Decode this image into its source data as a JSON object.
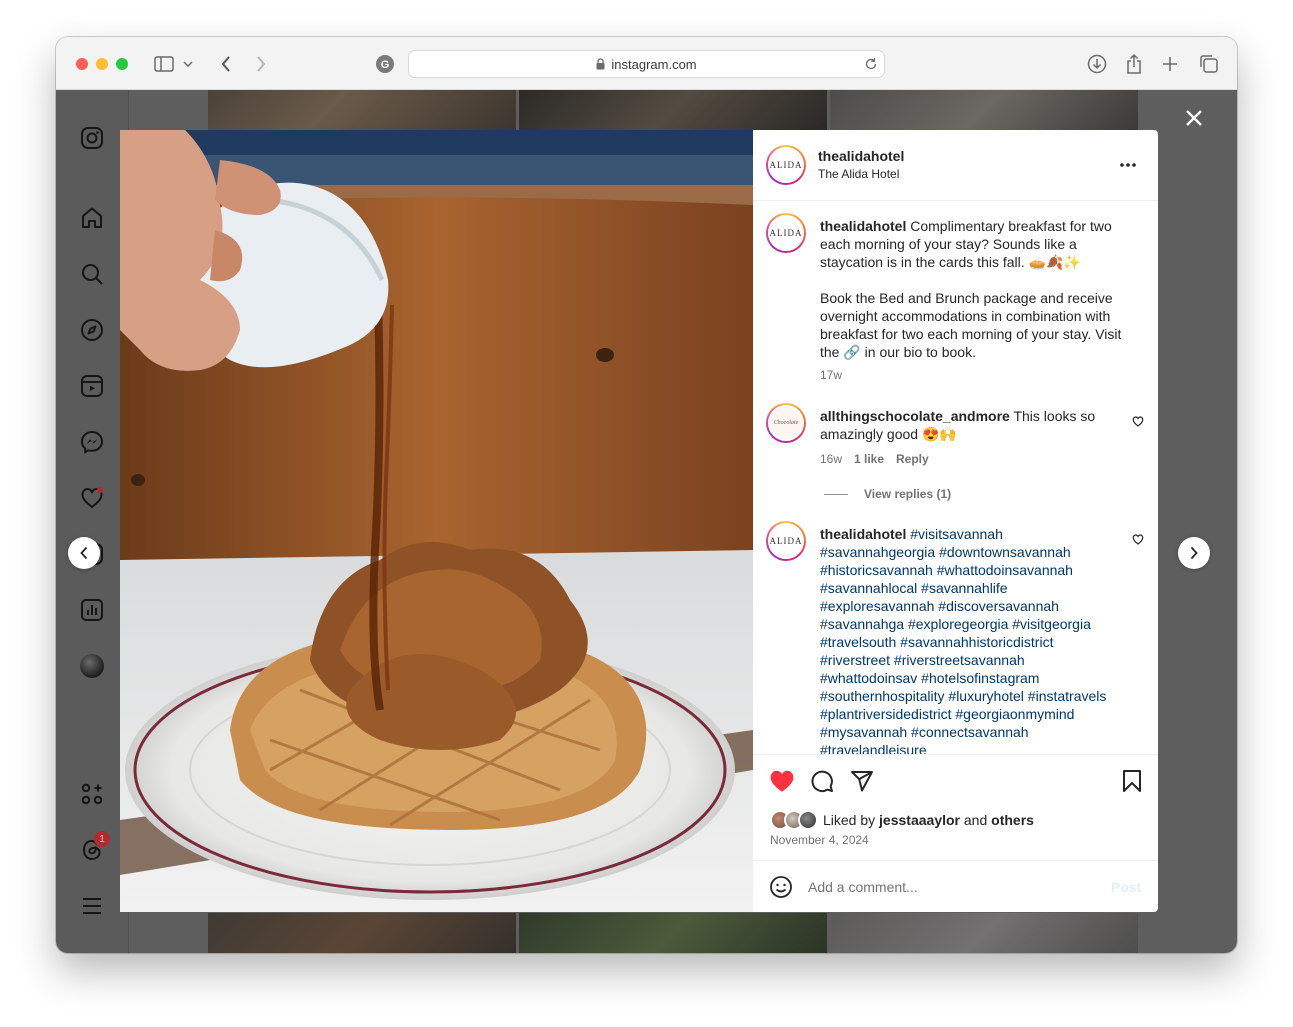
{
  "browser": {
    "url": "instagram.com",
    "icons": [
      "sidebar-toggle-icon",
      "chevron-down-icon",
      "back-icon",
      "forward-icon",
      "site-settings-icon",
      "lock-icon",
      "reload-icon",
      "download-icon",
      "share-icon",
      "new-tab-icon",
      "tab-overview-icon"
    ]
  },
  "post": {
    "account": {
      "username": "thealidahotel",
      "display_name": "The Alida Hotel",
      "avatar_text": "ALIDA"
    },
    "caption": {
      "username": "thealidahotel",
      "text_line1": "Complimentary breakfast for two each morning of your stay? Sounds like a staycation is in the cards this fall. 🥧🍂✨",
      "text_line2": "Book the Bed and Brunch package and receive overnight accommodations in combination with breakfast for two each morning of your stay. Visit the 🔗 in our bio to book.",
      "age": "17w"
    },
    "comments": [
      {
        "username": "allthingschocolate_andmore",
        "text": "This looks so amazingly good 😍🙌",
        "age": "16w",
        "likes": "1 like",
        "reply_label": "Reply",
        "view_replies": "View replies (1)"
      },
      {
        "username": "thealidahotel",
        "hashtags": "#visitsavannah #savannahgeorgia #downtownsavannah #historicsavannah #whattodoinsavannah #savannahlocal #savannahlife #exploresavannah #discoversavannah #savannahga #exploregeorgia #visitgeorgia #travelsouth #savannahhistoricdistrict #riverstreet #riverstreetsavannah #whattodoinsav #hotelsofinstagram #southernhospitality #luxuryhotel #instatravels #plantriversidedistrict #georgiaonmymind #mysavannah #connectsavannah #travelandleisure"
      }
    ],
    "liked_by_prefix": "Liked by",
    "liked_by_user": "jesstaaaylor",
    "liked_by_and": "and",
    "liked_by_others": "others",
    "date": "November 4, 2024",
    "comment_placeholder": "Add a comment...",
    "post_button": "Post"
  },
  "sidebar": {
    "icons": [
      "instagram-logo-icon",
      "home-icon",
      "search-icon",
      "explore-icon",
      "reels-icon",
      "messenger-icon",
      "notifications-icon",
      "create-icon",
      "dashboard-icon",
      "profile-avatar",
      "also-from-meta-icon",
      "threads-icon",
      "more-menu-icon"
    ],
    "threads_badge": "1"
  },
  "colors": {
    "like_red": "#ff3040",
    "link_blue": "#00376b",
    "post_button_faded": "#c0dffd"
  }
}
